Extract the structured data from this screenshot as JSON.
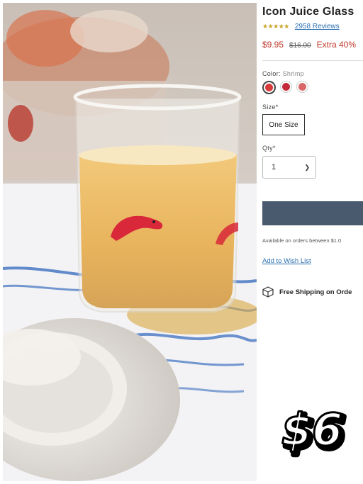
{
  "product": {
    "title": "Icon Juice Glass",
    "stars": "★★★★★",
    "reviews": "2958 Reviews",
    "price_now": "$9.95",
    "price_was": "$16.00",
    "price_extra": "Extra 40%",
    "rating": 5
  },
  "color": {
    "label": "Color:",
    "value": "Shrimp",
    "swatches": [
      {
        "name": "shrimp",
        "color": "#d83b3b",
        "selected": true
      },
      {
        "name": "red",
        "color": "#c42a3a",
        "selected": false
      },
      {
        "name": "pink",
        "color": "#d9686a",
        "selected": false
      }
    ]
  },
  "size": {
    "label": "Size*",
    "option": "One Size"
  },
  "qty": {
    "label": "Qty*",
    "value": "1"
  },
  "add_to_bag": {
    "color": "#4a5a6e"
  },
  "availability": "Available on orders between $1.0",
  "wishlist": "Add to Wish List",
  "shipping": "Free Shipping on Orde",
  "sticker": {
    "text": "$6"
  },
  "accent": {
    "price_red": "#c0392b",
    "link_blue": "#2a6fb0",
    "star_gold": "#c9a227"
  }
}
